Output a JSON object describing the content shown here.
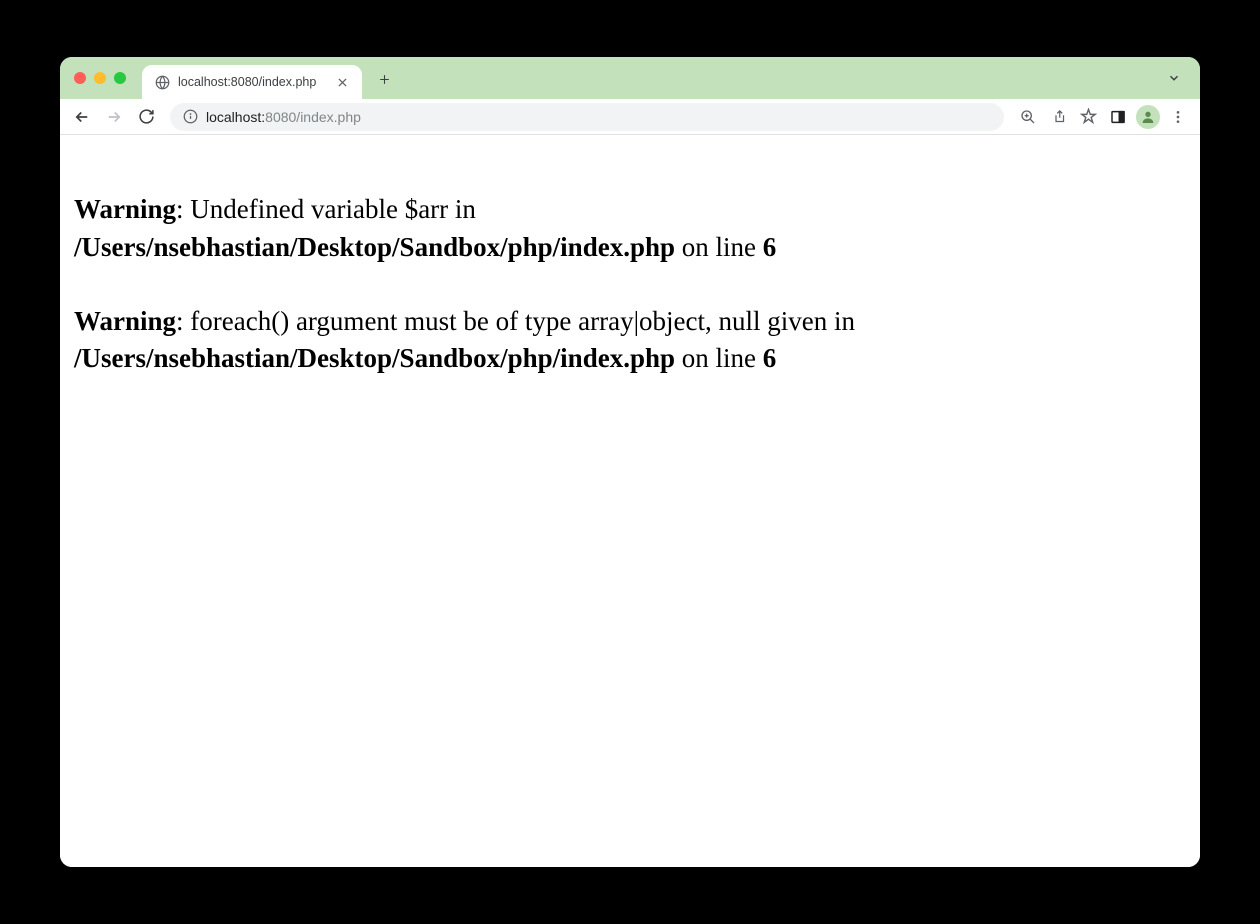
{
  "browser": {
    "tab": {
      "title": "localhost:8080/index.php"
    },
    "address": {
      "host": "localhost:",
      "path": "8080/index.php"
    }
  },
  "page": {
    "warnings": [
      {
        "label": "Warning",
        "message": ": Undefined variable $arr in ",
        "file": "/Users/nsebhastian/Desktop/Sandbox/php/index.php",
        "on_line_text": " on line ",
        "line": "6"
      },
      {
        "label": "Warning",
        "message": ": foreach() argument must be of type array|object, null given in ",
        "file": "/Users/nsebhastian/Desktop/Sandbox/php/index.php",
        "on_line_text": " on line ",
        "line": "6"
      }
    ]
  }
}
